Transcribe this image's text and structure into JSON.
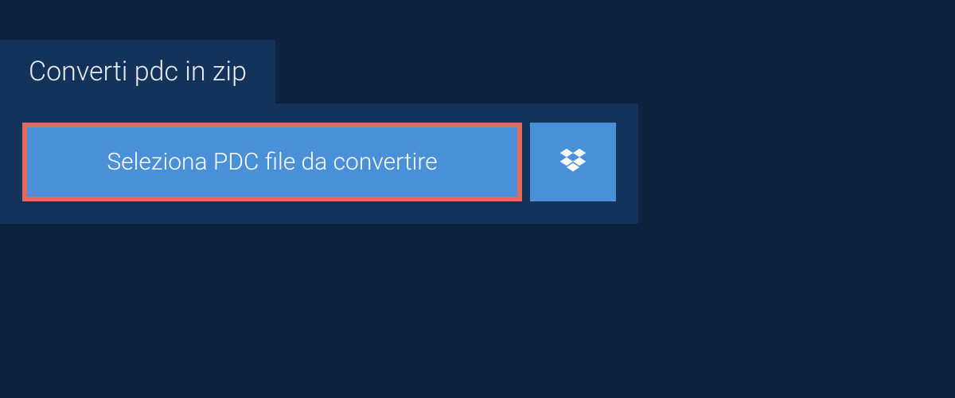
{
  "tab": {
    "title": "Converti pdc in zip"
  },
  "buttons": {
    "select_file_label": "Seleziona PDC file da convertire"
  },
  "colors": {
    "background": "#0c2340",
    "panel": "#13335a",
    "button": "#4a90d9",
    "highlight_border": "#e46a5e"
  }
}
